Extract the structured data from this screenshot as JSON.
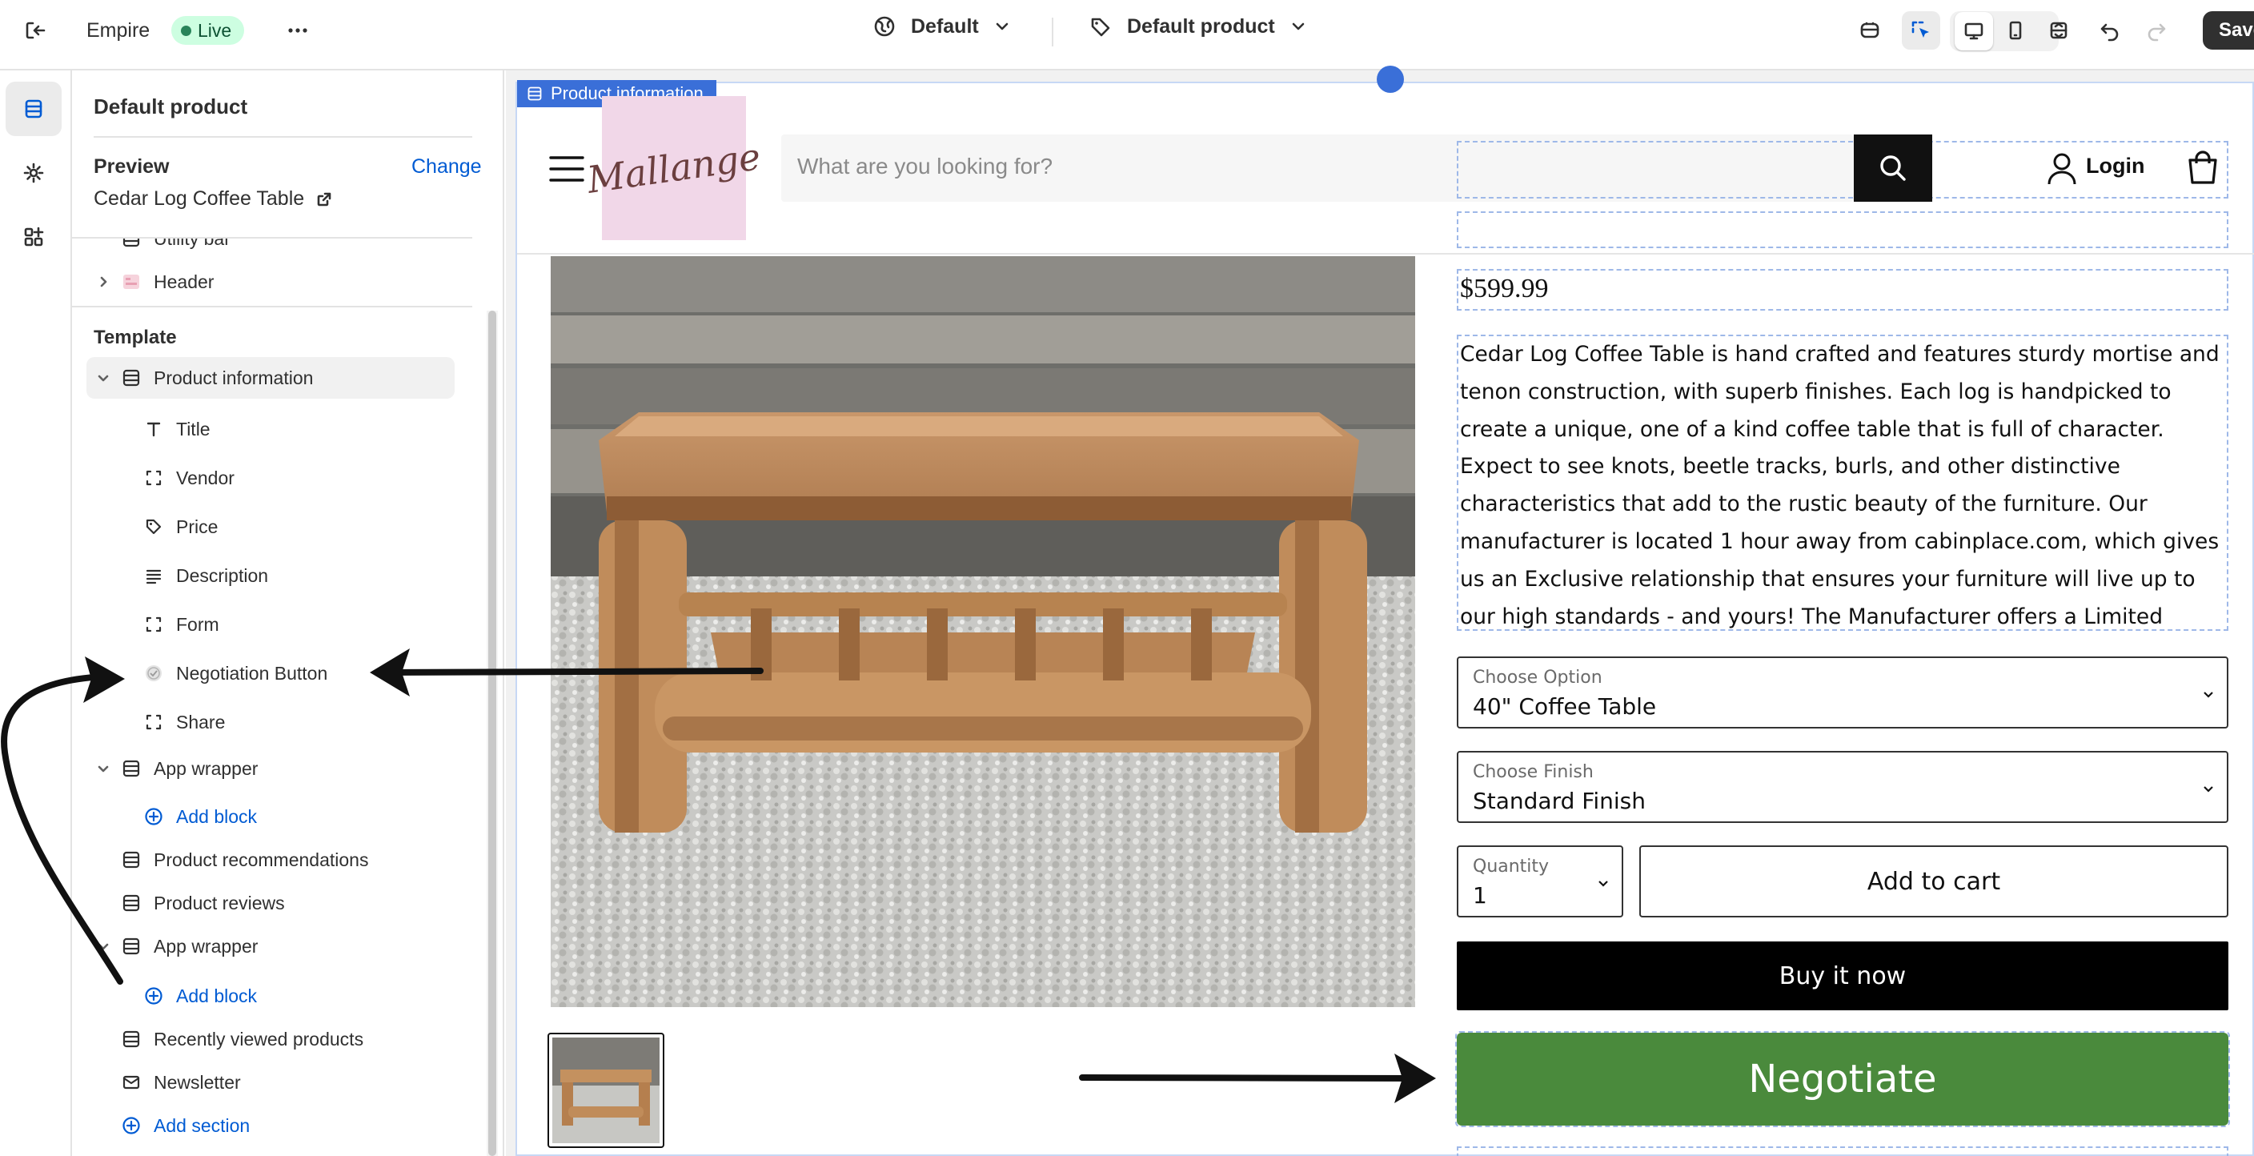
{
  "topbar": {
    "store_name": "Empire",
    "status_badge": "Live",
    "theme_selector": "Default",
    "template_selector": "Default product",
    "save_label": "Save"
  },
  "sidebar": {
    "title": "Default product",
    "preview_label": "Preview",
    "change_link": "Change",
    "preview_product": "Cedar Log Coffee Table",
    "utility_bar": "Utility bar",
    "header": "Header",
    "template_heading": "Template",
    "product_information": "Product information",
    "blocks": [
      "Title",
      "Vendor",
      "Price",
      "Description",
      "Form",
      "Negotiation Button",
      "Share"
    ],
    "app_wrapper_1": "App wrapper",
    "add_block_1": "Add block",
    "product_recommendations": "Product recommendations",
    "product_reviews": "Product reviews",
    "app_wrapper_2": "App wrapper",
    "add_block_2": "Add block",
    "recently_viewed": "Recently viewed products",
    "newsletter": "Newsletter",
    "add_section": "Add section"
  },
  "preview": {
    "section_tag": "Product information",
    "search_placeholder": "What are you looking for?",
    "logo_text": "Mallange",
    "login": "Login",
    "price": "$599.99",
    "description": "Cedar Log Coffee Table is hand crafted and features sturdy mortise and tenon construction, with superb finishes. Each log is handpicked to create a unique, one of a kind coffee table that is full of character. Expect to see knots, beetle tracks, burls, and other distinctive characteristics that add to the rustic beauty of the furniture. Our manufacturer is located 1 hour away from cabinplace.com, which gives us an Exclusive relationship that ensures your furniture will live up to our high standards - and yours! The Manufacturer offers a Limited Lifetime Warranty on all furniture products.",
    "option_label": "Choose Option",
    "option_value": "40\" Coffee Table",
    "finish_label": "Choose Finish",
    "finish_value": "Standard Finish",
    "quantity_label": "Quantity",
    "quantity_value": "1",
    "add_to_cart": "Add to cart",
    "buy_now": "Buy it now",
    "negotiate": "Negotiate"
  },
  "colors": {
    "accent": "#005bd3",
    "live_badge_bg": "#cdfee1",
    "negotiate_green": "#4a8a3c",
    "selection_blue": "#3a6fd8"
  }
}
